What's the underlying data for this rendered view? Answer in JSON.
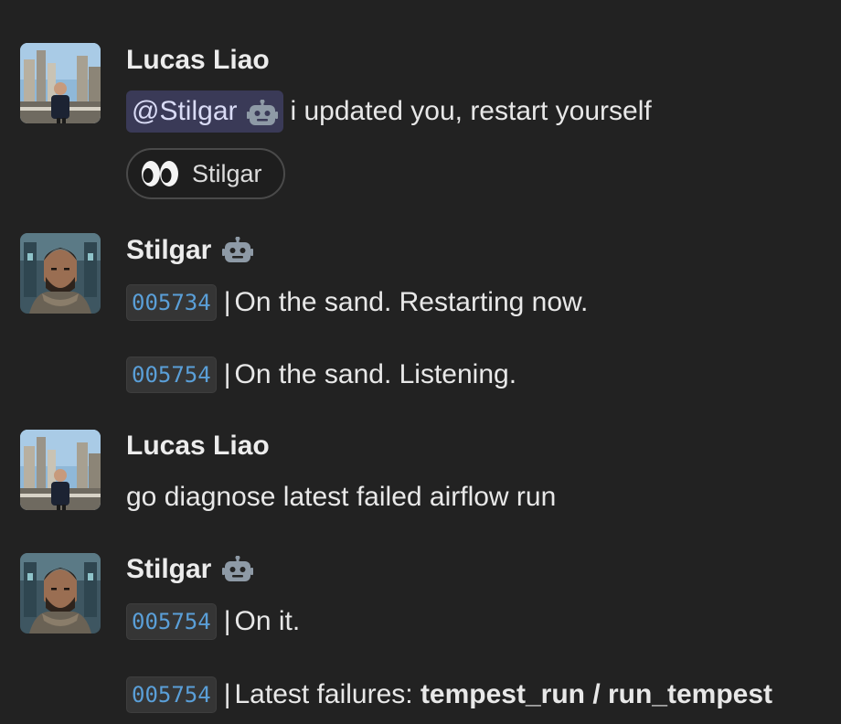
{
  "messages": [
    {
      "author": "Lucas Liao",
      "avatar": "city-photo-avatar",
      "is_bot": false,
      "lines": [
        {
          "mention": "@Stilgar",
          "text": "i updated you, restart yourself"
        }
      ],
      "reaction": {
        "emoji": "eyes-emoji",
        "label": "Stilgar"
      }
    },
    {
      "author": "Stilgar",
      "avatar": "bearded-warrior-avatar",
      "is_bot": true,
      "lines": [
        {
          "code": "005734",
          "sep": "|",
          "text": "On the sand. Restarting now."
        },
        {
          "code": "005754",
          "sep": "|",
          "text": "On the sand. Listening."
        }
      ]
    },
    {
      "author": "Lucas Liao",
      "avatar": "city-photo-avatar",
      "is_bot": false,
      "lines": [
        {
          "text": "go diagnose latest failed airflow run"
        }
      ]
    },
    {
      "author": "Stilgar",
      "avatar": "bearded-warrior-avatar",
      "is_bot": true,
      "lines": [
        {
          "code": "005754",
          "sep": "|",
          "text": "On it."
        },
        {
          "code": "005754",
          "sep": "|",
          "text": "Latest failures: ",
          "bold_text": "tempest_run / run_tempest"
        }
      ]
    }
  ],
  "colors": {
    "background": "#222222",
    "mention_bg": "#3a3a57",
    "code_text": "#5a9fd8"
  }
}
